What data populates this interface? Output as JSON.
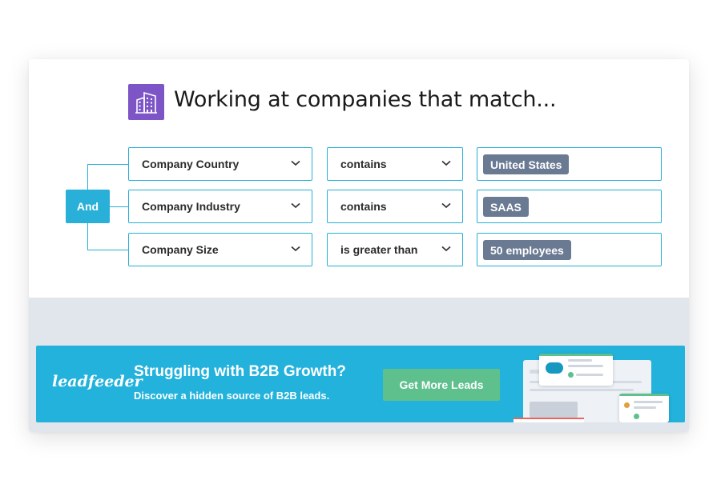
{
  "header": {
    "title": "Working at companies that match...",
    "icon": "building-icon"
  },
  "logic_operator": "And",
  "filters": [
    {
      "field": "Company Country",
      "operator": "contains",
      "value": "United States"
    },
    {
      "field": "Company Industry",
      "operator": "contains",
      "value": "SAAS"
    },
    {
      "field": "Company Size",
      "operator": "is greater than",
      "value": "50 employees"
    }
  ],
  "banner": {
    "logo": "leadfeeder",
    "headline": "Struggling with B2B Growth?",
    "subtext": "Discover a hidden source of B2B leads.",
    "cta": "Get More Leads"
  },
  "colors": {
    "accent": "#28b0d8",
    "icon_bg": "#7d55c7",
    "tag_bg": "#6a7a92",
    "banner_bg": "#23b2dc",
    "cta_bg": "#5ec08c"
  }
}
